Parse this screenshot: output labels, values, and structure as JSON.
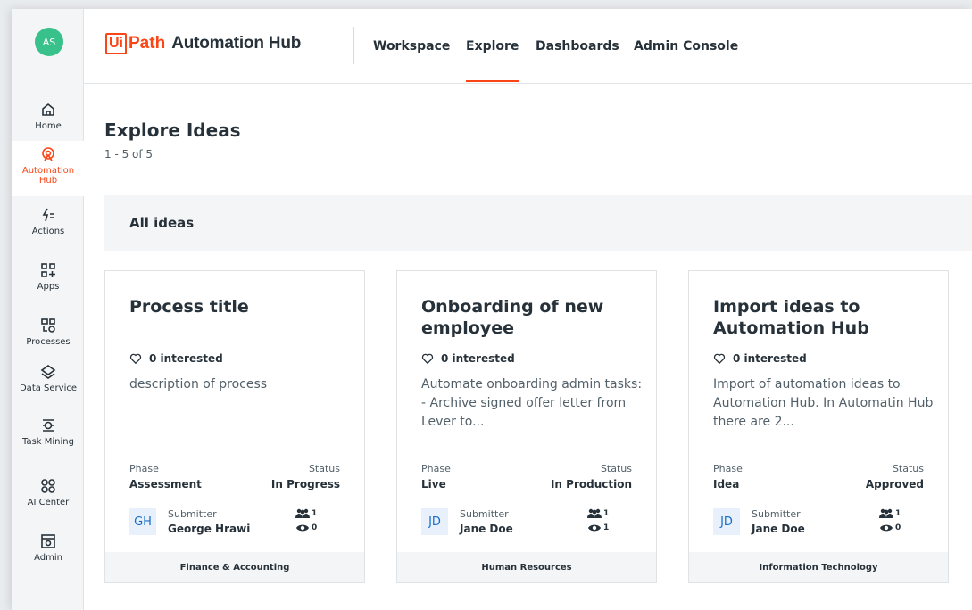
{
  "user": {
    "initials": "AS"
  },
  "rail": [
    {
      "label": "Home",
      "icon": "home-icon"
    },
    {
      "label": "Automation Hub",
      "icon": "automation-hub-icon"
    },
    {
      "label": "Actions",
      "icon": "actions-icon"
    },
    {
      "label": "Apps",
      "icon": "apps-icon"
    },
    {
      "label": "Processes",
      "icon": "processes-icon"
    },
    {
      "label": "Data Service",
      "icon": "data-service-icon"
    },
    {
      "label": "Task Mining",
      "icon": "task-mining-icon"
    },
    {
      "label": "AI Center",
      "icon": "ai-center-icon"
    },
    {
      "label": "Admin",
      "icon": "admin-icon"
    }
  ],
  "brand": {
    "ui": "Ui",
    "path": "Path",
    "product": "Automation Hub",
    "accent": "#fa4616"
  },
  "nav": [
    {
      "label": "Workspace"
    },
    {
      "label": "Explore"
    },
    {
      "label": "Dashboards"
    },
    {
      "label": "Admin Console"
    }
  ],
  "page": {
    "title": "Explore Ideas",
    "count": "1 - 5 of 5",
    "filter_label": "All ideas"
  },
  "labels": {
    "interested_suffix": "interested",
    "phase": "Phase",
    "status": "Status",
    "submitter": "Submitter"
  },
  "cards": [
    {
      "title": "Process title",
      "interested": "0 interested",
      "description": "description of process",
      "phase": "Assessment",
      "status": "In Progress",
      "submitter_initials": "GH",
      "submitter_name": "George Hrawi",
      "people": "1",
      "views": "0",
      "category": "Finance & Accounting"
    },
    {
      "title": "Onboarding of new employee",
      "interested": "0 interested",
      "description": "Automate onboarding admin tasks: - Archive signed offer letter from Lever to...",
      "phase": "Live",
      "status": "In Production",
      "submitter_initials": "JD",
      "submitter_name": "Jane Doe",
      "people": "1",
      "views": "1",
      "category": "Human Resources"
    },
    {
      "title": "Import ideas to Automation Hub",
      "interested": "0 interested",
      "description": "Import of automation ideas to Automation Hub. In Automatin Hub there are 2...",
      "phase": "Idea",
      "status": "Approved",
      "submitter_initials": "JD",
      "submitter_name": "Jane Doe",
      "people": "1",
      "views": "0",
      "category": "Information Technology"
    }
  ]
}
